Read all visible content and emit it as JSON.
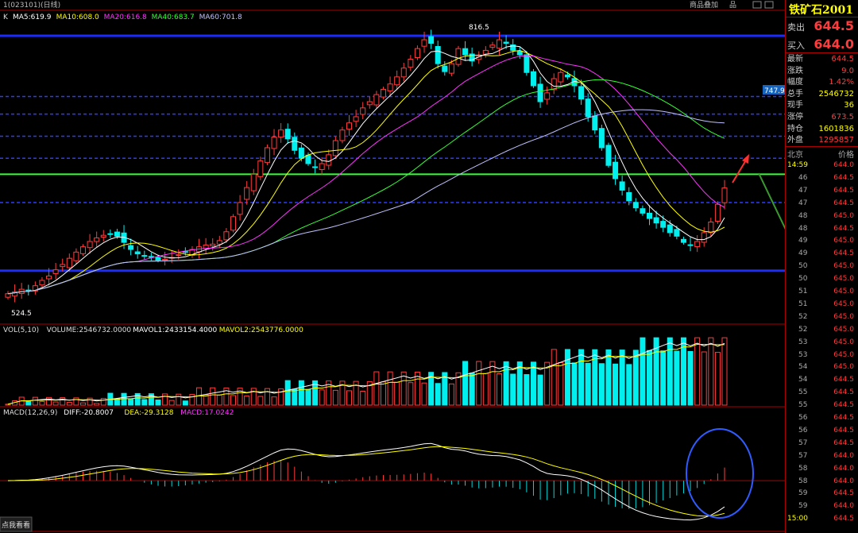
{
  "window": {
    "title": "1(023101)(日线)",
    "buttons": [
      "商品叠加",
      "品"
    ],
    "footer_button": "点我看看"
  },
  "indicators": {
    "ma_line": {
      "label": "K",
      "items": [
        {
          "text": "MA5:619.9",
          "color": "#ffffff"
        },
        {
          "text": "MA10:608.0",
          "color": "#ffff00"
        },
        {
          "text": "MA20:616.8",
          "color": "#ff33ff"
        },
        {
          "text": "MA40:683.7",
          "color": "#33ff33"
        },
        {
          "text": "MA60:701.8",
          "color": "#c0c0ff"
        }
      ]
    },
    "vol_line": {
      "items": [
        {
          "text": "VOL(5,10)",
          "color": "#dddddd"
        },
        {
          "text": "VOLUME:2546732.0000",
          "color": "#dddddd"
        },
        {
          "text": "MAVOL1:2433154.4000",
          "color": "#ffffff"
        },
        {
          "text": "MAVOL2:2543776.0000",
          "color": "#ffff00"
        }
      ]
    },
    "macd_line": {
      "items": [
        {
          "text": "MACD(12,26,9)",
          "color": "#dddddd"
        },
        {
          "text": "DIFF:-20.8007",
          "color": "#ffffff"
        },
        {
          "text": "DEA:-29.3128",
          "color": "#ffff00"
        },
        {
          "text": "MACD:17.0242",
          "color": "#ff33ff"
        }
      ]
    }
  },
  "annotations": {
    "high_label": "816.5",
    "low_label": "524.5",
    "price_tag": "747.9"
  },
  "quote": {
    "name": "铁矿石2001",
    "sell_label": "卖出",
    "sell_value": "644.5",
    "buy_label": "买入",
    "buy_value": "644.0",
    "rows": [
      {
        "label": "最新",
        "value": "644.5",
        "cls": "red"
      },
      {
        "label": "涨跌",
        "value": "9.0",
        "cls": "red"
      },
      {
        "label": "幅度",
        "value": "1.42%",
        "cls": "red"
      },
      {
        "label": "总手",
        "value": "2546732",
        "cls": "yel"
      },
      {
        "label": "现手",
        "value": "36",
        "cls": "yel"
      },
      {
        "label": "涨停",
        "value": "673.5",
        "cls": "red"
      },
      {
        "label": "持仓",
        "value": "1601836",
        "cls": "yel"
      },
      {
        "label": "外盘",
        "value": "1295857",
        "cls": "red"
      }
    ],
    "tick_header": {
      "left": "北京",
      "right": "价格"
    },
    "ticks": [
      {
        "t": "14:59",
        "p": "644.0",
        "tc": "yel",
        "pc": "red"
      },
      {
        "t": "46",
        "p": "644.5",
        "tc": "dim",
        "pc": "red"
      },
      {
        "t": "47",
        "p": "644.5",
        "tc": "dim",
        "pc": "red"
      },
      {
        "t": "47",
        "p": "644.5",
        "tc": "dim",
        "pc": "red"
      },
      {
        "t": "48",
        "p": "645.0",
        "tc": "dim",
        "pc": "red"
      },
      {
        "t": "48",
        "p": "644.5",
        "tc": "dim",
        "pc": "red"
      },
      {
        "t": "49",
        "p": "645.0",
        "tc": "dim",
        "pc": "red"
      },
      {
        "t": "49",
        "p": "644.5",
        "tc": "dim",
        "pc": "red"
      },
      {
        "t": "50",
        "p": "645.0",
        "tc": "dim",
        "pc": "red"
      },
      {
        "t": "50",
        "p": "645.0",
        "tc": "dim",
        "pc": "red"
      },
      {
        "t": "51",
        "p": "645.0",
        "tc": "dim",
        "pc": "red"
      },
      {
        "t": "51",
        "p": "645.0",
        "tc": "dim",
        "pc": "red"
      },
      {
        "t": "52",
        "p": "645.0",
        "tc": "dim",
        "pc": "red"
      },
      {
        "t": "52",
        "p": "645.0",
        "tc": "dim",
        "pc": "red"
      },
      {
        "t": "53",
        "p": "645.0",
        "tc": "dim",
        "pc": "red"
      },
      {
        "t": "53",
        "p": "645.0",
        "tc": "dim",
        "pc": "red"
      },
      {
        "t": "54",
        "p": "645.0",
        "tc": "dim",
        "pc": "red"
      },
      {
        "t": "54",
        "p": "644.5",
        "tc": "dim",
        "pc": "red"
      },
      {
        "t": "55",
        "p": "644.5",
        "tc": "dim",
        "pc": "red"
      },
      {
        "t": "55",
        "p": "644.5",
        "tc": "dim",
        "pc": "red"
      },
      {
        "t": "56",
        "p": "644.5",
        "tc": "dim",
        "pc": "red"
      },
      {
        "t": "56",
        "p": "644.5",
        "tc": "dim",
        "pc": "red"
      },
      {
        "t": "57",
        "p": "644.5",
        "tc": "dim",
        "pc": "red"
      },
      {
        "t": "57",
        "p": "644.0",
        "tc": "dim",
        "pc": "red"
      },
      {
        "t": "58",
        "p": "644.0",
        "tc": "dim",
        "pc": "red"
      },
      {
        "t": "58",
        "p": "644.0",
        "tc": "dim",
        "pc": "red"
      },
      {
        "t": "59",
        "p": "644.5",
        "tc": "dim",
        "pc": "red"
      },
      {
        "t": "59",
        "p": "644.0",
        "tc": "dim",
        "pc": "red"
      },
      {
        "t": "15:00",
        "p": "644.5",
        "tc": "yel",
        "pc": "red"
      }
    ]
  },
  "chart_data": {
    "type": "candlestick",
    "price_range": [
      505,
      830
    ],
    "levels": [
      {
        "value": 816.5,
        "kind": "blue-solid"
      },
      {
        "value": 747.9,
        "kind": "blue-dash"
      },
      {
        "value": 728,
        "kind": "blue-dash"
      },
      {
        "value": 703,
        "kind": "blue-dash"
      },
      {
        "value": 678,
        "kind": "blue-dash"
      },
      {
        "value": 660,
        "kind": "green-solid"
      },
      {
        "value": 628,
        "kind": "blue-dash"
      },
      {
        "value": 551,
        "kind": "blue-solid"
      }
    ],
    "closes": [
      525,
      527,
      530,
      528,
      534,
      540,
      545,
      552,
      558,
      565,
      572,
      578,
      584,
      588,
      591,
      592,
      590,
      583,
      575,
      570,
      568,
      566,
      563,
      564,
      566,
      569,
      572,
      575,
      578,
      580,
      581,
      585,
      595,
      612,
      628,
      645,
      660,
      675,
      690,
      702,
      710,
      700,
      687,
      678,
      672,
      668,
      672,
      682,
      698,
      710,
      718,
      725,
      735,
      742,
      750,
      756,
      762,
      770,
      780,
      790,
      802,
      812,
      808,
      785,
      776,
      785,
      802,
      795,
      788,
      793,
      800,
      806,
      812,
      808,
      800,
      795,
      775,
      760,
      742,
      752,
      768,
      775,
      770,
      760,
      745,
      725,
      710,
      690,
      670,
      655,
      642,
      630,
      622,
      616,
      610,
      605,
      600,
      594,
      590,
      583,
      580,
      584,
      594,
      606,
      626,
      644.5
    ],
    "volume_range": [
      0,
      3200000
    ],
    "macd_range": [
      -55,
      75
    ]
  }
}
